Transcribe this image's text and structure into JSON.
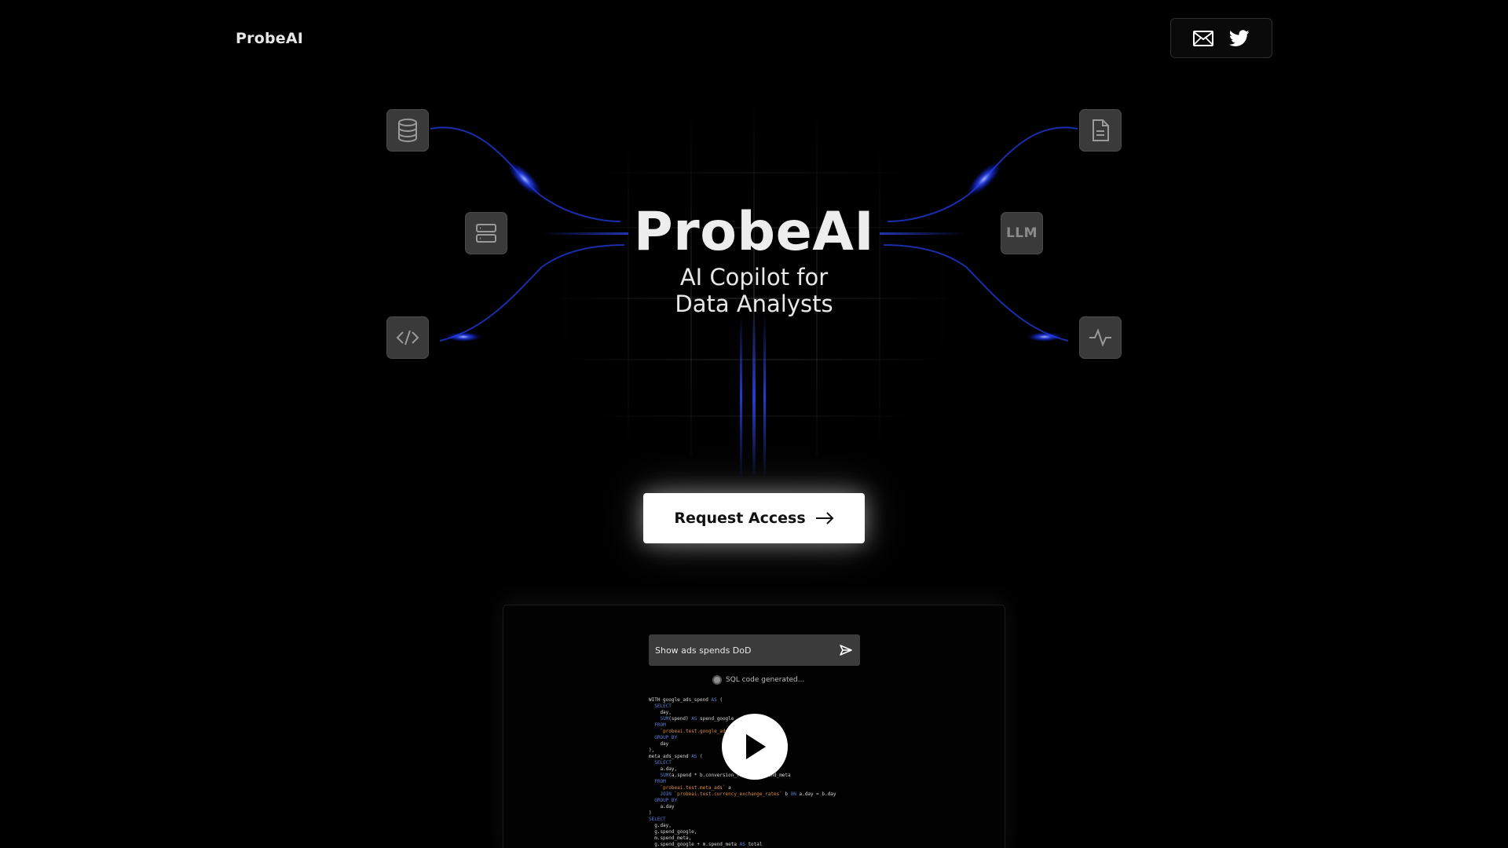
{
  "header": {
    "logo_text": "ProbeAI",
    "social": [
      {
        "icon": "mail-icon"
      },
      {
        "icon": "twitter-icon"
      }
    ]
  },
  "hero": {
    "title": "ProbeAI",
    "subtitle_line1": "AI Copilot for",
    "subtitle_line2": "Data Analysts",
    "tiles": [
      {
        "icon": "database-icon"
      },
      {
        "icon": "server-icon"
      },
      {
        "icon": "code-icon"
      },
      {
        "icon": "document-icon"
      },
      {
        "icon": "llm-icon",
        "label": "LLM"
      },
      {
        "icon": "activity-icon"
      }
    ],
    "accent_color": "#2d4bff"
  },
  "cta": {
    "label": "Request Access"
  },
  "video": {
    "prompt_text": "Show ads spends DoD",
    "status_text": "SQL code generated..."
  }
}
